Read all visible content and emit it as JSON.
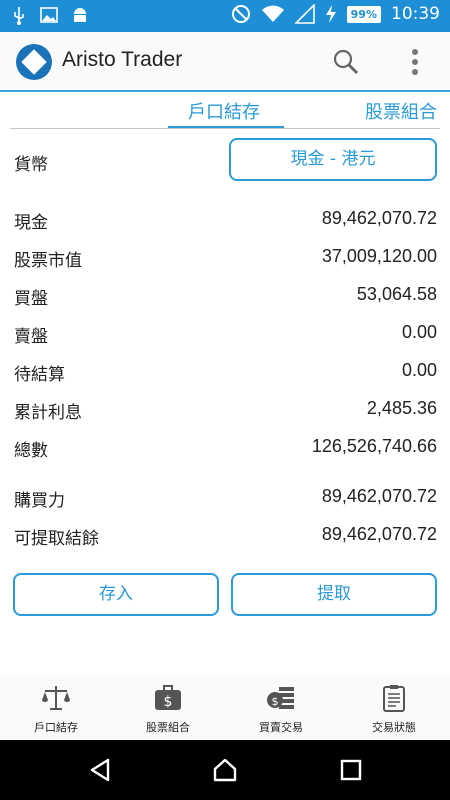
{
  "status_bar": {
    "icons_left": [
      "usb-icon",
      "image-icon",
      "android-icon"
    ],
    "icons_right": [
      "do-not-disturb-icon",
      "wifi-icon",
      "signal-icon",
      "charging-icon"
    ],
    "battery": "99%",
    "time": "10:39"
  },
  "app_bar": {
    "title": "Aristo Trader"
  },
  "tabs": {
    "active": "戶口結存",
    "other": "股票組合"
  },
  "currency": {
    "label": "貨幣",
    "selected": "現金 - 港元"
  },
  "balances": [
    {
      "label": "現金",
      "value": "89,462,070.72"
    },
    {
      "label": "股票市值",
      "value": "37,009,120.00"
    },
    {
      "label": "買盤",
      "value": "53,064.58"
    },
    {
      "label": "賣盤",
      "value": "0.00"
    },
    {
      "label": "待結算",
      "value": "0.00"
    },
    {
      "label": "累計利息",
      "value": "2,485.36"
    },
    {
      "label": "總數",
      "value": "126,526,740.66"
    },
    {
      "label": "購買力",
      "value": "89,462,070.72"
    },
    {
      "label": "可提取結餘",
      "value": "89,462,070.72"
    }
  ],
  "actions": {
    "deposit": "存入",
    "withdraw": "提取"
  },
  "bottom_nav": [
    {
      "label": "戶口結存",
      "icon": "scale-icon"
    },
    {
      "label": "股票組合",
      "icon": "briefcase-icon"
    },
    {
      "label": "買賣交易",
      "icon": "coins-icon"
    },
    {
      "label": "交易狀態",
      "icon": "clipboard-icon"
    }
  ],
  "colors": {
    "status_bar": "#1e8fd6",
    "accent": "#2b9ad8"
  }
}
